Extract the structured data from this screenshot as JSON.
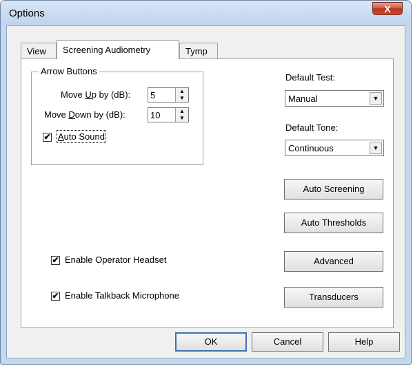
{
  "window": {
    "title": "Options",
    "close_glyph": "X"
  },
  "tabs": [
    {
      "label": "View"
    },
    {
      "label": "Screening Audiometry"
    },
    {
      "label": "Tymp"
    }
  ],
  "arrow_buttons": {
    "title": "Arrow Buttons",
    "move_up": {
      "label_pre": "Move ",
      "label_key": "U",
      "label_post": "p by (dB):",
      "value": "5"
    },
    "move_down": {
      "label_pre": "Move ",
      "label_key": "D",
      "label_post": "own by (dB):",
      "value": "10"
    },
    "auto_sound": {
      "label_key": "A",
      "label_post": "uto Sound",
      "checked": true
    }
  },
  "defaults": {
    "test_label": "Default Test:",
    "test_value": "Manual",
    "tone_label": "Default Tone:",
    "tone_value": "Continuous"
  },
  "options": {
    "operator_headset": {
      "label": "Enable Operator Headset",
      "checked": true
    },
    "talkback_mic": {
      "label": "Enable Talkback Microphone",
      "checked": true
    }
  },
  "side_buttons": {
    "auto_screening": "Auto Screening",
    "auto_thresholds": "Auto Thresholds",
    "advanced": "Advanced",
    "transducers": "Transducers"
  },
  "bottom_buttons": {
    "ok": "OK",
    "cancel": "Cancel",
    "help": "Help"
  },
  "glyphs": {
    "check": "✔",
    "spin_up": "▲",
    "spin_down": "▼",
    "dropdown": "▼"
  }
}
